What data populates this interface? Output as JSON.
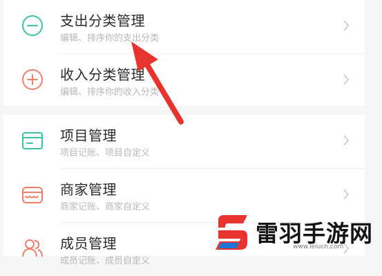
{
  "groups": [
    {
      "items": [
        {
          "title": "支出分类管理",
          "subtitle": "编辑、排序你的支出分类",
          "icon": "minus-circle-icon"
        },
        {
          "title": "收入分类管理",
          "subtitle": "编辑、排序你的收入分类",
          "icon": "plus-circle-icon"
        }
      ]
    },
    {
      "items": [
        {
          "title": "项目管理",
          "subtitle": "项目记账、项目自定义",
          "icon": "folder-icon"
        },
        {
          "title": "商家管理",
          "subtitle": "商家记账、商家自定义",
          "icon": "shop-icon"
        },
        {
          "title": "成员管理",
          "subtitle": "成员记账、成员自定义",
          "icon": "members-icon"
        }
      ]
    }
  ],
  "colors": {
    "expense_icon": "#3cc3a0",
    "income_icon": "#f07f6c",
    "project_icon": "#3cc3a0",
    "shop_icon": "#f07f6c",
    "members_icon": "#f07f6c",
    "arrow": "#e8342e",
    "watermark_red": "#e8342e",
    "watermark_blue": "#1e73d8"
  },
  "watermark": {
    "brand": "雷羽手游网",
    "url": "www.leiucn.com"
  }
}
